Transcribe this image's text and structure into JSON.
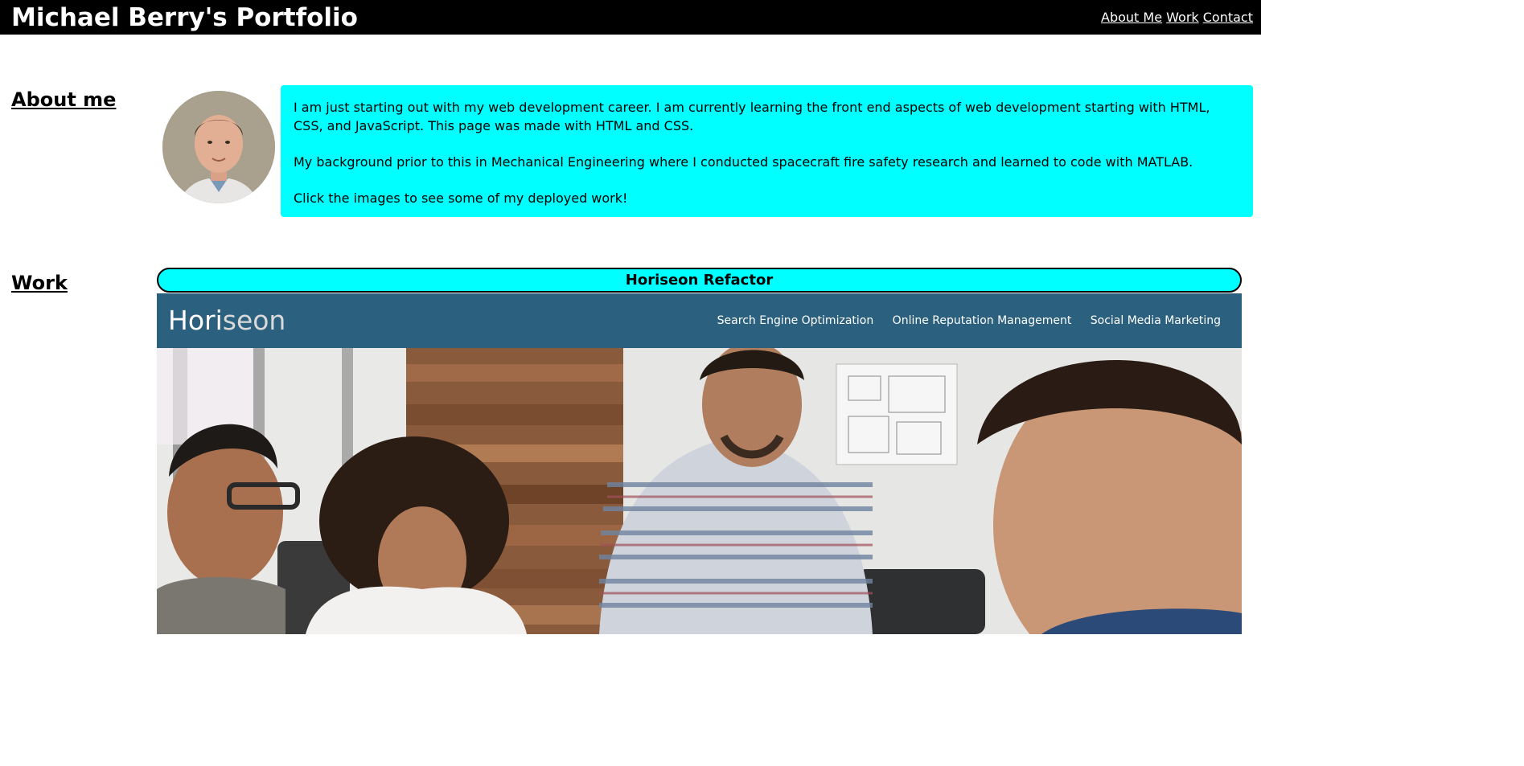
{
  "header": {
    "title": "Michael Berry's Portfolio",
    "nav": [
      {
        "label": "About Me"
      },
      {
        "label": "Work"
      },
      {
        "label": "Contact"
      }
    ]
  },
  "about": {
    "heading": "About me",
    "paragraphs": [
      "I am just starting out with my web development career. I am currently learning the front end aspects of web development starting with HTML, CSS, and JavaScript. This page was made with HTML and CSS.",
      "My background prior to this in Mechanical Engineering where I conducted spacecraft fire safety research and learned to code with MATLAB.",
      "Click the images to see some of my deployed work!"
    ]
  },
  "work": {
    "heading": "Work",
    "projects": [
      {
        "title": "Horiseon Refactor",
        "screenshot": {
          "logo_part1": "Hori",
          "logo_part2": "seon",
          "nav": [
            "Search Engine Optimization",
            "Online Reputation Management",
            "Social Media Marketing"
          ]
        }
      }
    ]
  },
  "colors": {
    "topbar": "#000000",
    "accent": "#00ffff",
    "horiseon_header": "#2b607f"
  }
}
